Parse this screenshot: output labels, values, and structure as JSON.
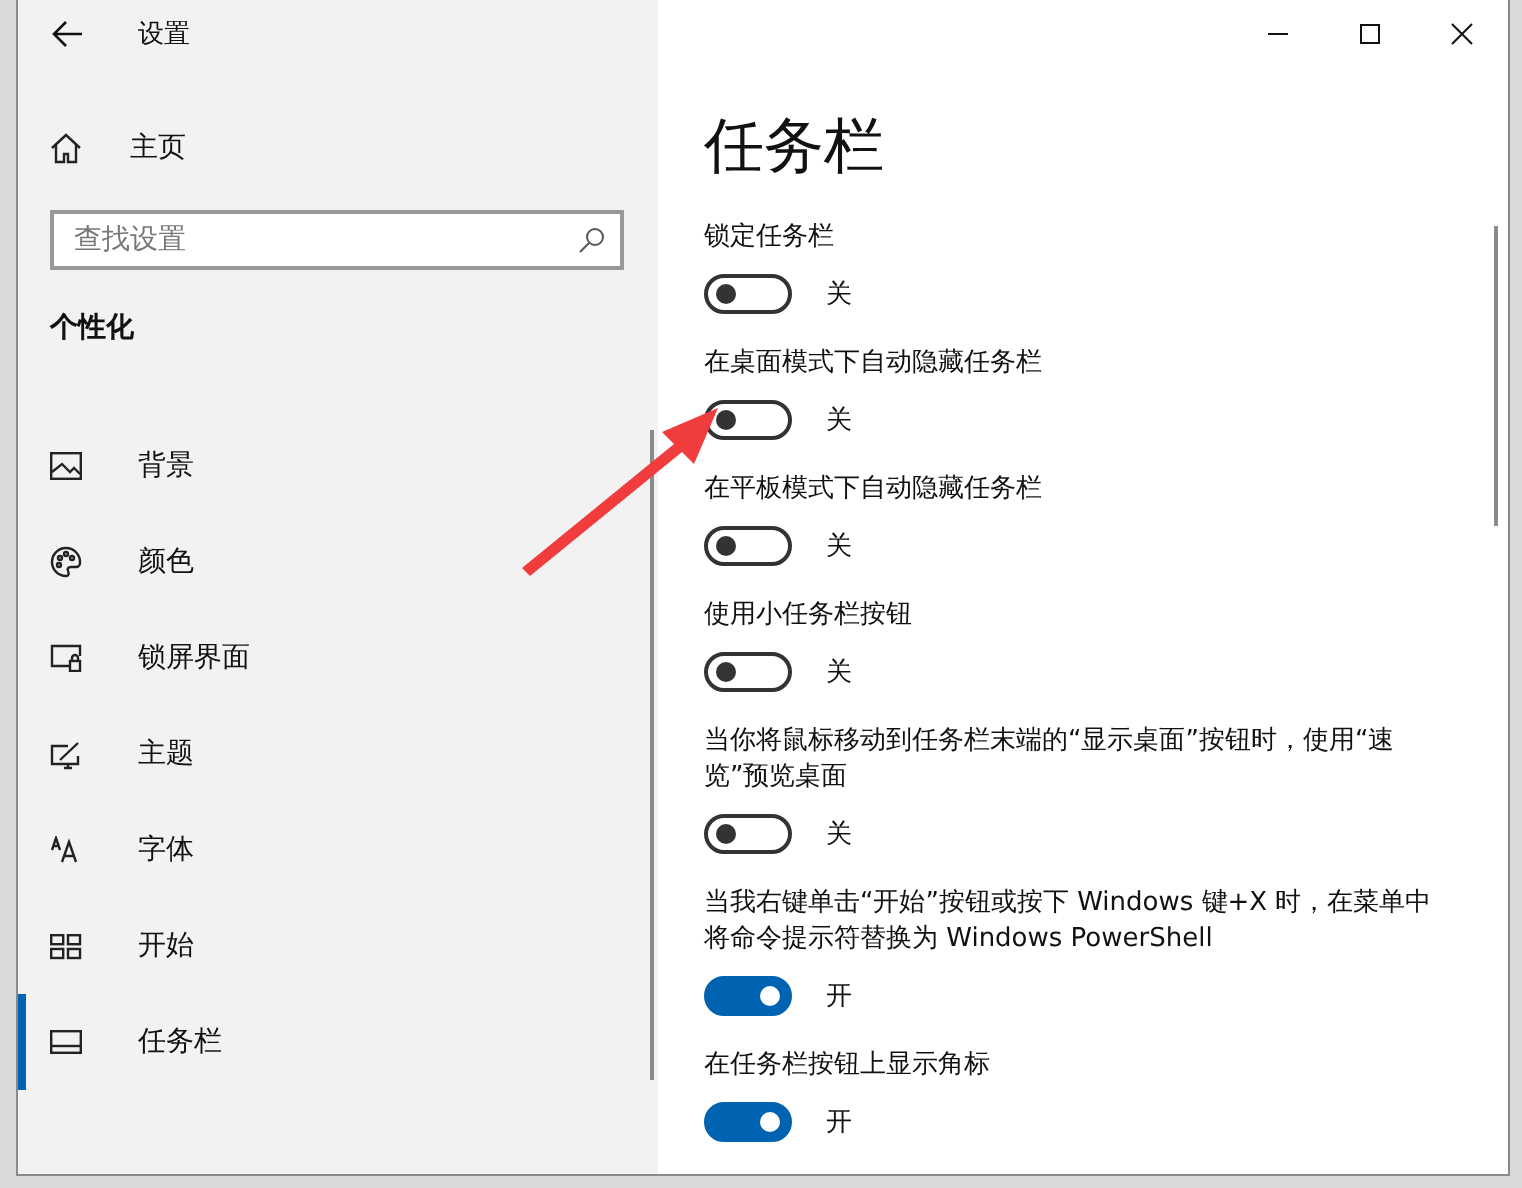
{
  "window": {
    "title": "设置"
  },
  "sidebar": {
    "home": "主页",
    "search": {
      "placeholder": "查找设置"
    },
    "section": "个性化",
    "items": [
      {
        "label": "背景",
        "selected": false
      },
      {
        "label": "颜色",
        "selected": false
      },
      {
        "label": "锁屏界面",
        "selected": false
      },
      {
        "label": "主题",
        "selected": false
      },
      {
        "label": "字体",
        "selected": false
      },
      {
        "label": "开始",
        "selected": false
      },
      {
        "label": "任务栏",
        "selected": true
      }
    ]
  },
  "page": {
    "title": "任务栏",
    "settings": [
      {
        "label": "锁定任务栏",
        "on": false,
        "state": "关"
      },
      {
        "label": "在桌面模式下自动隐藏任务栏",
        "on": false,
        "state": "关"
      },
      {
        "label": "在平板模式下自动隐藏任务栏",
        "on": false,
        "state": "关"
      },
      {
        "label": "使用小任务栏按钮",
        "on": false,
        "state": "关"
      },
      {
        "label": "当你将鼠标移动到任务栏末端的“显示桌面”按钮时，使用“速览”预览桌面",
        "on": false,
        "state": "关"
      },
      {
        "label": "当我右键单击“开始”按钮或按下 Windows 键+X 时，在菜单中将命令提示符替换为 Windows PowerShell",
        "on": true,
        "state": "开"
      },
      {
        "label": "在任务栏按钮上显示角标",
        "on": true,
        "state": "开"
      }
    ]
  }
}
